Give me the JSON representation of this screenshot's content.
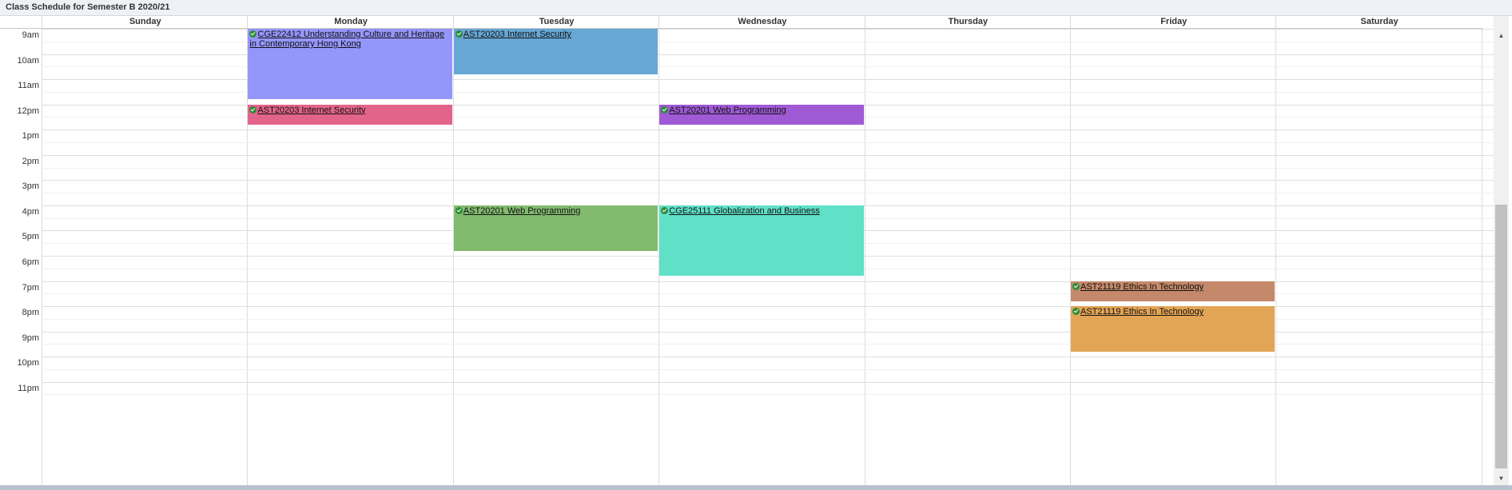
{
  "title": "Class Schedule for Semester B 2020/21",
  "days": [
    "Sunday",
    "Monday",
    "Tuesday",
    "Wednesday",
    "Thursday",
    "Friday",
    "Saturday"
  ],
  "hours": [
    "9am",
    "10am",
    "11am",
    "12pm",
    "1pm",
    "2pm",
    "3pm",
    "4pm",
    "5pm",
    "6pm",
    "7pm",
    "8pm",
    "9pm",
    "10pm",
    "11pm"
  ],
  "events": [
    {
      "label": "CGE22412 Understanding Culture and Heritage in Contemporary Hong Kong",
      "day": 1,
      "start": 9.0,
      "end": 11.8,
      "color": "#9496fb"
    },
    {
      "label": "AST20203 Internet Security",
      "day": 2,
      "start": 9.0,
      "end": 10.8,
      "color": "#66a7d5"
    },
    {
      "label": "AST20203 Internet Security",
      "day": 1,
      "start": 12.0,
      "end": 12.8,
      "color": "#e2648a"
    },
    {
      "label": "AST20201 Web Programming",
      "day": 3,
      "start": 12.0,
      "end": 12.8,
      "color": "#a05ad6"
    },
    {
      "label": "AST20201 Web Programming",
      "day": 2,
      "start": 16.0,
      "end": 17.8,
      "color": "#82bb6e"
    },
    {
      "label": "CGE25111 Globalization and Business",
      "day": 3,
      "start": 16.0,
      "end": 18.8,
      "color": "#60e0c6"
    },
    {
      "label": "AST21119 Ethics In Technology",
      "day": 5,
      "start": 19.0,
      "end": 19.8,
      "color": "#c4896a"
    },
    {
      "label": "AST21119 Ethics In Technology",
      "day": 5,
      "start": 20.0,
      "end": 21.8,
      "color": "#e2a455"
    }
  ],
  "scrollbar": {
    "up_icon": "arrow-up",
    "down_icon": "arrow-down"
  }
}
